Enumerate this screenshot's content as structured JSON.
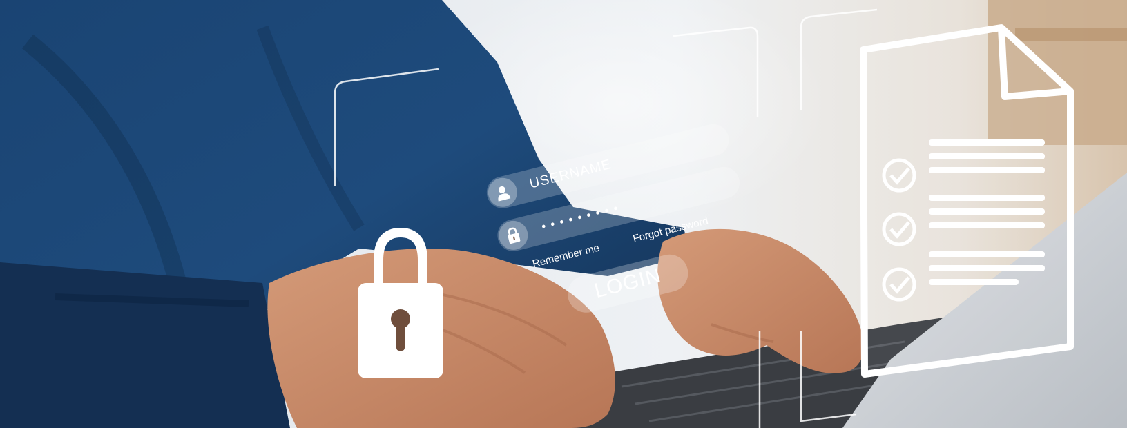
{
  "login": {
    "username_placeholder": "USERNAME",
    "password_mask": "•••••••••",
    "remember_label": "Remember me",
    "forgot_label": "Forgot password",
    "button_label": "LOGIN"
  },
  "icons": {
    "user": "user-icon",
    "lock_small": "lock-icon",
    "padlock": "padlock-icon",
    "document": "document-icon",
    "check": "check-circle-icon"
  },
  "colors": {
    "shirt_navy": "#1d4a78",
    "background_light": "#eceff2",
    "wood": "#c8a889",
    "skin": "#c98b6b",
    "overlay_white": "#ffffff"
  }
}
